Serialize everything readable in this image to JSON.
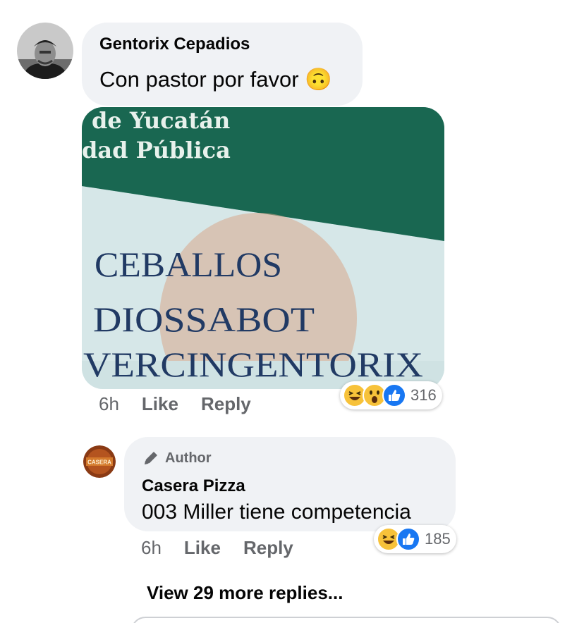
{
  "comment": {
    "author": "Gentorix Cepadios",
    "text": "Con pastor por favor 🙃",
    "photo": {
      "line1": "de Yucatán",
      "line2": "dad Pública",
      "surname1": "CEBALLOS",
      "surname2": "DIOSSABOT",
      "given": "VERCINGENTORIX"
    },
    "time": "6h",
    "like_label": "Like",
    "reply_label": "Reply",
    "reaction_icons": [
      "laugh-icon",
      "wow-icon",
      "like-icon"
    ],
    "reaction_count": "316"
  },
  "reply": {
    "badge": "Author",
    "author": "Casera Pizza",
    "avatar_text": "CASERA",
    "text": "003 Miller tiene competencia",
    "time": "6h",
    "like_label": "Like",
    "reply_label": "Reply",
    "reaction_icons": [
      "laugh-icon",
      "like-icon"
    ],
    "reaction_count": "185"
  },
  "view_more_label": "View 29 more replies...",
  "colors": {
    "bubble_bg": "#f0f2f5",
    "muted_text": "#65676b",
    "like_blue": "#1877f2",
    "emoji_yellow": "#f7c23a"
  }
}
